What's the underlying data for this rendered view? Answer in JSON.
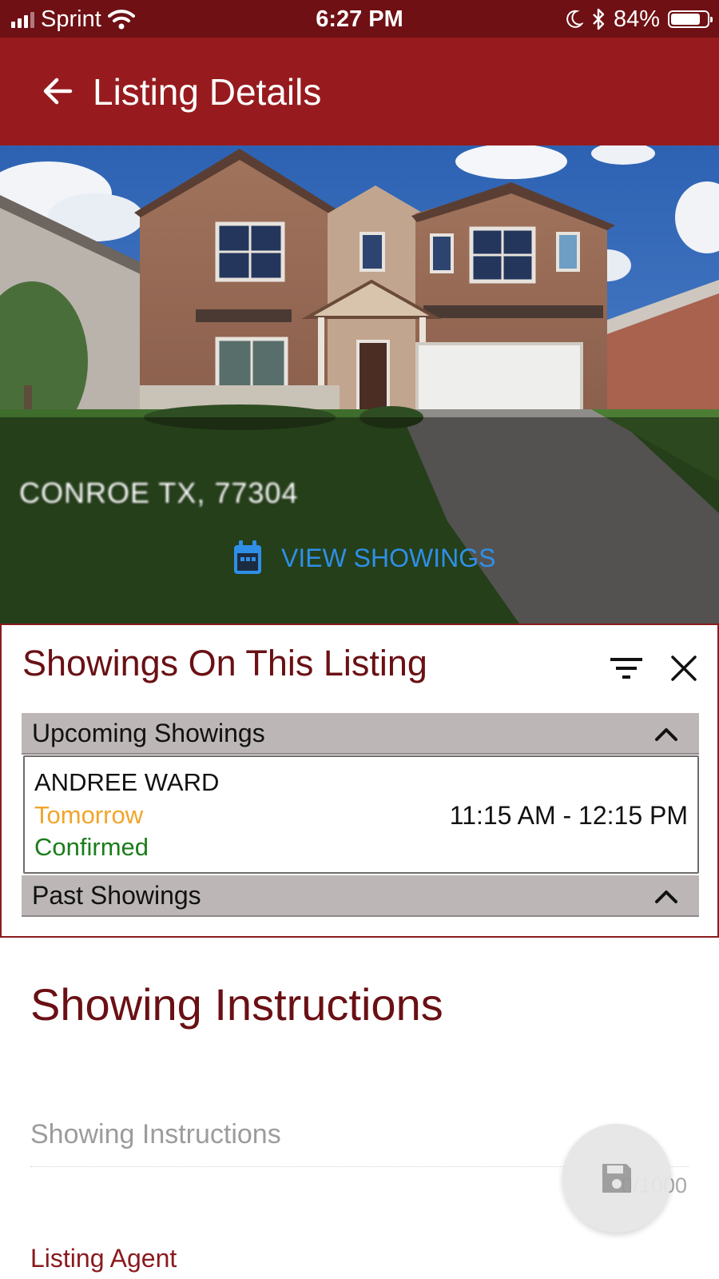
{
  "status_bar": {
    "carrier": "Sprint",
    "time": "6:27 PM",
    "battery": "84%",
    "battery_level": 0.84,
    "icons": [
      "signal-icon",
      "wifi-icon",
      "moon-icon",
      "bluetooth-icon",
      "battery-icon"
    ]
  },
  "app_bar": {
    "title": "Listing Details",
    "back_icon": "arrow-left-icon",
    "background": "#971b1e"
  },
  "listing": {
    "address": "CONROE TX, 77304",
    "view_showings_label": "VIEW SHOWINGS",
    "view_showings_icon": "calendar-icon",
    "link_color": "#2f8fe8"
  },
  "showings_panel": {
    "title": "Showings On This Listing",
    "filter_icon": "filter-icon",
    "close_icon": "close-icon",
    "upcoming_label": "Upcoming Showings",
    "past_label": "Past Showings",
    "upcoming": [
      {
        "agent": "ANDREE WARD",
        "day": "Tomorrow",
        "status": "Confirmed",
        "time": "11:15 AM - 12:15 PM"
      }
    ]
  },
  "instructions": {
    "title": "Showing Instructions",
    "placeholder": "Showing Instructions",
    "char_count": "0/1000",
    "save_icon": "save-icon"
  },
  "listing_agent_label": "Listing Agent",
  "colors": {
    "accent": "#971b1e",
    "heading": "#6a1014",
    "day": "#f1a52b",
    "confirmed": "#1a7d1a"
  }
}
